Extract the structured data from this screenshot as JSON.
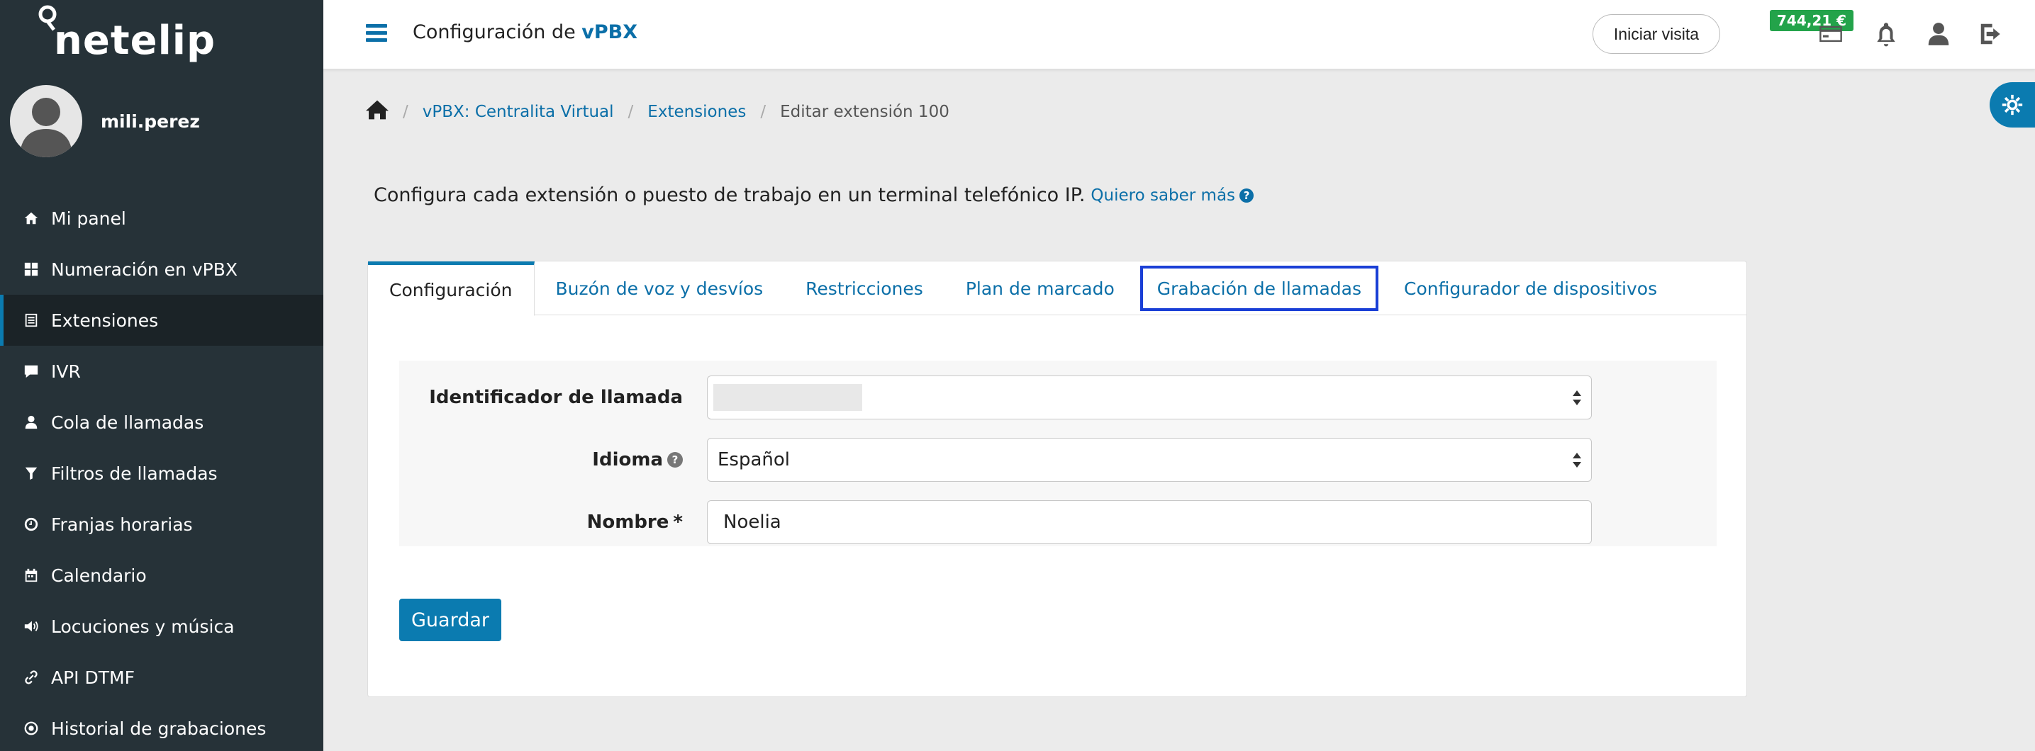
{
  "brand": {
    "name": "netelip"
  },
  "user": {
    "username": "mili.perez"
  },
  "sidebar": {
    "items": [
      {
        "label": "Mi panel",
        "icon": "home-icon"
      },
      {
        "label": "Numeración en vPBX",
        "icon": "grid-icon"
      },
      {
        "label": "Extensiones",
        "icon": "list-icon",
        "active": true
      },
      {
        "label": "IVR",
        "icon": "chat-icon"
      },
      {
        "label": "Cola de llamadas",
        "icon": "person-icon"
      },
      {
        "label": "Filtros de llamadas",
        "icon": "filter-icon"
      },
      {
        "label": "Franjas horarias",
        "icon": "clock-icon"
      },
      {
        "label": "Calendario",
        "icon": "calendar-icon"
      },
      {
        "label": "Locuciones y música",
        "icon": "speaker-icon"
      },
      {
        "label": "API DTMF",
        "icon": "link-icon"
      },
      {
        "label": "Historial de grabaciones",
        "icon": "record-icon"
      }
    ]
  },
  "header": {
    "title_prefix": "Configuración de",
    "title_highlight": "vPBX",
    "visit_button": "Iniciar visita",
    "balance": "744,21 €",
    "icons": [
      "card-icon",
      "bell-icon",
      "user-icon",
      "logout-icon"
    ]
  },
  "breadcrumb": {
    "items": [
      "vPBX: Centralita Virtual",
      "Extensiones"
    ],
    "current": "Editar extensión 100"
  },
  "intro": {
    "text": "Configura cada extensión o puesto de trabajo en un terminal telefónico IP.",
    "link": "Quiero saber más"
  },
  "tabs": [
    {
      "label": "Configuración",
      "active": true
    },
    {
      "label": "Buzón de voz y desvíos"
    },
    {
      "label": "Restricciones"
    },
    {
      "label": "Plan de marcado"
    },
    {
      "label": "Grabación de llamadas",
      "focused": true
    },
    {
      "label": "Configurador de dispositivos"
    }
  ],
  "form": {
    "caller_id": {
      "label": "Identificador de llamada",
      "value": ""
    },
    "language": {
      "label": "Idioma",
      "value": "Español"
    },
    "name": {
      "label": "Nombre",
      "required_mark": "*",
      "value": "Noelia"
    }
  },
  "actions": {
    "save": "Guardar"
  },
  "colors": {
    "sidebar_bg": "#263238",
    "accent": "#0b7bb0",
    "balance": "#23a34a",
    "focus": "#1a3fd6"
  }
}
